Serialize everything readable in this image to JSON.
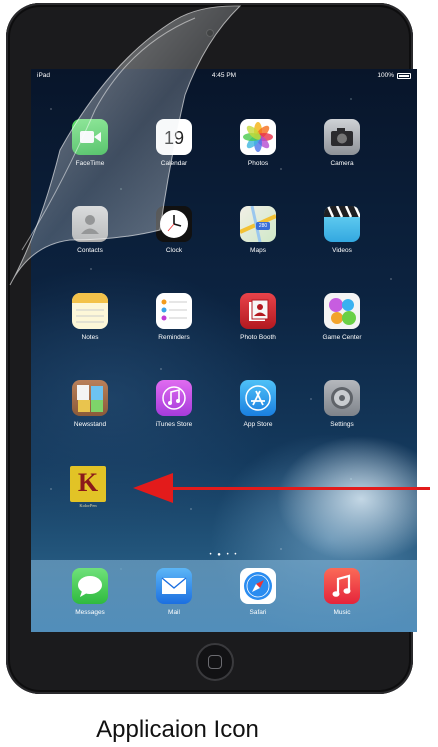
{
  "status_bar": {
    "device": "iPad",
    "time": "4:45 PM",
    "battery": "100%"
  },
  "apps": [
    {
      "label": "FaceTime"
    },
    {
      "label": "Calendar",
      "icon_text": "19"
    },
    {
      "label": "Photos"
    },
    {
      "label": "Camera"
    },
    {
      "label": "Contacts"
    },
    {
      "label": "Clock"
    },
    {
      "label": "Maps",
      "icon_text": "280"
    },
    {
      "label": "Videos"
    },
    {
      "label": "Notes"
    },
    {
      "label": "Reminders"
    },
    {
      "label": "Photo Booth"
    },
    {
      "label": "Game Center"
    },
    {
      "label": "Newsstand"
    },
    {
      "label": "iTunes Store"
    },
    {
      "label": "App Store"
    },
    {
      "label": "Settings"
    }
  ],
  "custom_app": {
    "letter": "K",
    "name": "KolorPen"
  },
  "page_indicator": "• ● • •",
  "dock": [
    {
      "label": "Messages"
    },
    {
      "label": "Mail"
    },
    {
      "label": "Safari"
    },
    {
      "label": "Music"
    }
  ],
  "caption": "Applicaion Icon",
  "colors": {
    "arrow": "#e31b1b",
    "device_bezel": "#1b1b1d"
  }
}
